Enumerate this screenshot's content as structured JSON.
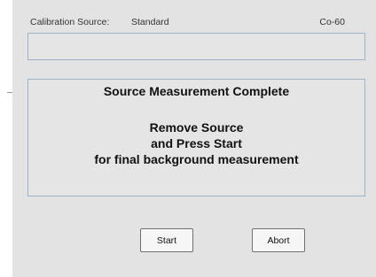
{
  "calibration": {
    "label": "Calibration Source:",
    "value": "Standard",
    "isotope": "Co-60"
  },
  "message": {
    "title": "Source Measurement Complete",
    "line1": "Remove Source",
    "line2": "and Press Start",
    "line3": "for final background measurement"
  },
  "buttons": {
    "start": "Start",
    "abort": "Abort"
  }
}
